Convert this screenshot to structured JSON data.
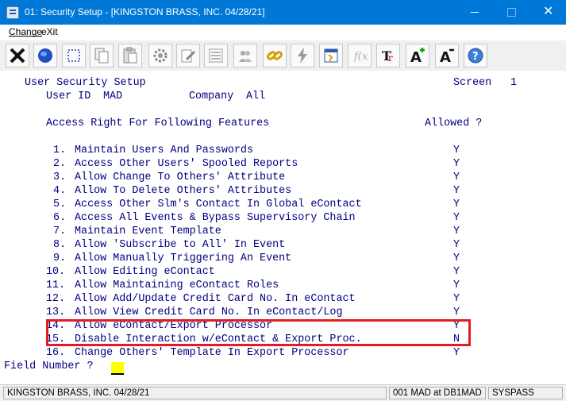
{
  "window": {
    "title": "01: Security Setup - [KINGSTON BRASS, INC. 04/28/21]"
  },
  "menu": {
    "change": "Change",
    "exit": "eXit"
  },
  "toolbar": {
    "buttons": [
      "close-x-icon",
      "globe-icon",
      "select-icon",
      "copy-icon",
      "paste-icon",
      "settings-gear-icon",
      "edit-icon",
      "list-icon",
      "users-icon",
      "chain-link-icon",
      "lightning-icon",
      "calendar-icon",
      "formula-icon",
      "font-icon",
      "font-increase-icon",
      "font-decrease-icon",
      "help-icon"
    ]
  },
  "screen": {
    "heading": "User Security Setup",
    "screen_label": "Screen",
    "screen_number": "1",
    "user_id_label": "User ID",
    "user_id": "MAD",
    "company_label": "Company",
    "company": "All",
    "access_header": "Access Right For Following Features",
    "allowed_header": "Allowed ?",
    "features": [
      {
        "num": "1.",
        "label": "Maintain Users And Passwords",
        "allowed": "Y"
      },
      {
        "num": "2.",
        "label": "Access Other Users' Spooled Reports",
        "allowed": "Y"
      },
      {
        "num": "3.",
        "label": "Allow Change To Others' Attribute",
        "allowed": "Y"
      },
      {
        "num": "4.",
        "label": "Allow To Delete Others' Attributes",
        "allowed": "Y"
      },
      {
        "num": "5.",
        "label": "Access Other Slm's Contact In Global eContact",
        "allowed": "Y"
      },
      {
        "num": "6.",
        "label": "Access All Events & Bypass Supervisory Chain",
        "allowed": "Y"
      },
      {
        "num": "7.",
        "label": "Maintain Event Template",
        "allowed": "Y"
      },
      {
        "num": "8.",
        "label": "Allow 'Subscribe to All' In Event",
        "allowed": "Y"
      },
      {
        "num": "9.",
        "label": "Allow Manually Triggering An Event",
        "allowed": "Y"
      },
      {
        "num": "10.",
        "label": "Allow Editing eContact",
        "allowed": "Y"
      },
      {
        "num": "11.",
        "label": "Allow Maintaining eContact Roles",
        "allowed": "Y"
      },
      {
        "num": "12.",
        "label": "Allow Add/Update Credit Card No. In eContact",
        "allowed": "Y"
      },
      {
        "num": "13.",
        "label": "Allow View Credit Card No. In eContact/Log",
        "allowed": "Y"
      },
      {
        "num": "14.",
        "label": "Allow eContact/Export Processor",
        "allowed": "Y"
      },
      {
        "num": "15.",
        "label": "Disable Interaction w/eContact & Export Proc.",
        "allowed": "N"
      },
      {
        "num": "16.",
        "label": "Change Others' Template In Export Processor",
        "allowed": "Y"
      }
    ],
    "prompt": "Field Number ?"
  },
  "status": {
    "company": "KINGSTON BRASS, INC. 04/28/21",
    "session": "001 MAD at DB1MAD",
    "db": "SYSPASS"
  },
  "colors": {
    "terminal_text": "#000080",
    "highlight_box": "#e41b23",
    "titlebar": "#0078d7",
    "cursor": "#ffff00"
  }
}
